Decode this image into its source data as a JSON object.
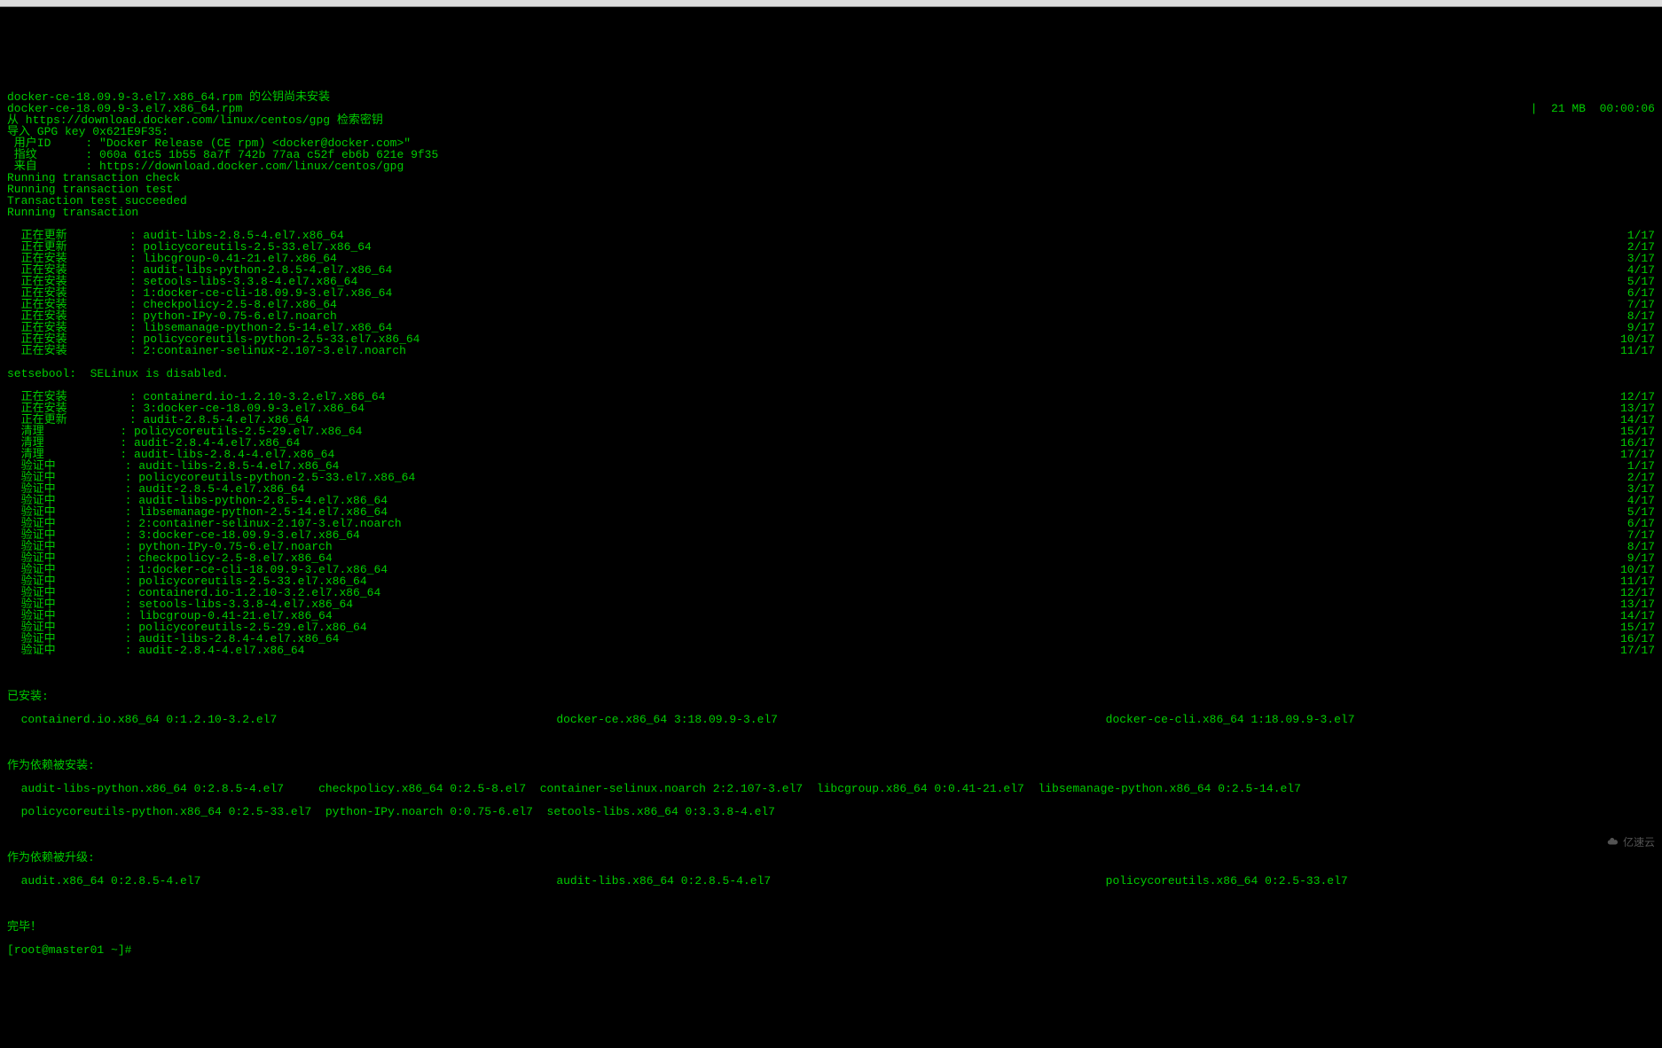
{
  "intro": [
    "docker-ce-18.09.9-3.el7.x86_64.rpm 的公钥尚未安装",
    "docker-ce-18.09.9-3.el7.x86_64.rpm                                                                                                                                    |  21 MB  00:00:06",
    "从 https://download.docker.com/linux/centos/gpg 检索密钥",
    "导入 GPG key 0x621E9F35:",
    " 用户ID     : \"Docker Release (CE rpm) <docker@docker.com>\"",
    " 指纹       : 060a 61c5 1b55 8a7f 742b 77aa c52f eb6b 621e 9f35",
    " 来自       : https://download.docker.com/linux/centos/gpg",
    "Running transaction check",
    "Running transaction test",
    "Transaction test succeeded",
    "Running transaction"
  ],
  "pkg_steps": [
    {
      "action": "正在更新",
      "pkg": "audit-libs-2.8.5-4.el7.x86_64",
      "n": "1/17"
    },
    {
      "action": "正在更新",
      "pkg": "policycoreutils-2.5-33.el7.x86_64",
      "n": "2/17"
    },
    {
      "action": "正在安装",
      "pkg": "libcgroup-0.41-21.el7.x86_64",
      "n": "3/17"
    },
    {
      "action": "正在安装",
      "pkg": "audit-libs-python-2.8.5-4.el7.x86_64",
      "n": "4/17"
    },
    {
      "action": "正在安装",
      "pkg": "setools-libs-3.3.8-4.el7.x86_64",
      "n": "5/17"
    },
    {
      "action": "正在安装",
      "pkg": "1:docker-ce-cli-18.09.9-3.el7.x86_64",
      "n": "6/17"
    },
    {
      "action": "正在安装",
      "pkg": "checkpolicy-2.5-8.el7.x86_64",
      "n": "7/17"
    },
    {
      "action": "正在安装",
      "pkg": "python-IPy-0.75-6.el7.noarch",
      "n": "8/17"
    },
    {
      "action": "正在安装",
      "pkg": "libsemanage-python-2.5-14.el7.x86_64",
      "n": "9/17"
    },
    {
      "action": "正在安装",
      "pkg": "policycoreutils-python-2.5-33.el7.x86_64",
      "n": "10/17"
    },
    {
      "action": "正在安装",
      "pkg": "2:container-selinux-2.107-3.el7.noarch",
      "n": "11/17"
    }
  ],
  "selinux_msg": "setsebool:  SELinux is disabled.",
  "pkg_steps2": [
    {
      "action": "正在安装",
      "pkg": "containerd.io-1.2.10-3.2.el7.x86_64",
      "n": "12/17"
    },
    {
      "action": "正在安装",
      "pkg": "3:docker-ce-18.09.9-3.el7.x86_64",
      "n": "13/17"
    },
    {
      "action": "正在更新",
      "pkg": "audit-2.8.5-4.el7.x86_64",
      "n": "14/17"
    },
    {
      "action": "清理",
      "pkg": "policycoreutils-2.5-29.el7.x86_64",
      "n": "15/17"
    },
    {
      "action": "清理",
      "pkg": "audit-2.8.4-4.el7.x86_64",
      "n": "16/17"
    },
    {
      "action": "清理",
      "pkg": "audit-libs-2.8.4-4.el7.x86_64",
      "n": "17/17"
    },
    {
      "action": "验证中",
      "pkg": "audit-libs-2.8.5-4.el7.x86_64",
      "n": "1/17"
    },
    {
      "action": "验证中",
      "pkg": "policycoreutils-python-2.5-33.el7.x86_64",
      "n": "2/17"
    },
    {
      "action": "验证中",
      "pkg": "audit-2.8.5-4.el7.x86_64",
      "n": "3/17"
    },
    {
      "action": "验证中",
      "pkg": "audit-libs-python-2.8.5-4.el7.x86_64",
      "n": "4/17"
    },
    {
      "action": "验证中",
      "pkg": "libsemanage-python-2.5-14.el7.x86_64",
      "n": "5/17"
    },
    {
      "action": "验证中",
      "pkg": "2:container-selinux-2.107-3.el7.noarch",
      "n": "6/17"
    },
    {
      "action": "验证中",
      "pkg": "3:docker-ce-18.09.9-3.el7.x86_64",
      "n": "7/17"
    },
    {
      "action": "验证中",
      "pkg": "python-IPy-0.75-6.el7.noarch",
      "n": "8/17"
    },
    {
      "action": "验证中",
      "pkg": "checkpolicy-2.5-8.el7.x86_64",
      "n": "9/17"
    },
    {
      "action": "验证中",
      "pkg": "1:docker-ce-cli-18.09.9-3.el7.x86_64",
      "n": "10/17"
    },
    {
      "action": "验证中",
      "pkg": "policycoreutils-2.5-33.el7.x86_64",
      "n": "11/17"
    },
    {
      "action": "验证中",
      "pkg": "containerd.io-1.2.10-3.2.el7.x86_64",
      "n": "12/17"
    },
    {
      "action": "验证中",
      "pkg": "setools-libs-3.3.8-4.el7.x86_64",
      "n": "13/17"
    },
    {
      "action": "验证中",
      "pkg": "libcgroup-0.41-21.el7.x86_64",
      "n": "14/17"
    },
    {
      "action": "验证中",
      "pkg": "policycoreutils-2.5-29.el7.x86_64",
      "n": "15/17"
    },
    {
      "action": "验证中",
      "pkg": "audit-libs-2.8.4-4.el7.x86_64",
      "n": "16/17"
    },
    {
      "action": "验证中",
      "pkg": "audit-2.8.4-4.el7.x86_64",
      "n": "17/17"
    }
  ],
  "installed_header": "已安装:",
  "installed_cols": [
    "  containerd.io.x86_64 0:1.2.10-3.2.el7",
    "docker-ce.x86_64 3:18.09.9-3.el7",
    "docker-ce-cli.x86_64 1:18.09.9-3.el7"
  ],
  "deps_header": "作为依赖被安装:",
  "deps_row1": [
    "  audit-libs-python.x86_64 0:2.8.5-4.el7",
    "checkpolicy.x86_64 0:2.5-8.el7",
    "container-selinux.noarch 2:2.107-3.el7",
    "libcgroup.x86_64 0:0.41-21.el7",
    "libsemanage-python.x86_64 0:2.5-14.el7"
  ],
  "deps_row2": [
    "  policycoreutils-python.x86_64 0:2.5-33.el7",
    "python-IPy.noarch 0:0.75-6.el7",
    "setools-libs.x86_64 0:3.3.8-4.el7"
  ],
  "upgraded_header": "作为依赖被升级:",
  "upgraded_cols": [
    "  audit.x86_64 0:2.8.5-4.el7",
    "audit-libs.x86_64 0:2.8.5-4.el7",
    "policycoreutils.x86_64 0:2.5-33.el7"
  ],
  "complete": "完毕！",
  "prompt": "[root@master01 ~]# ",
  "watermark": "亿速云"
}
